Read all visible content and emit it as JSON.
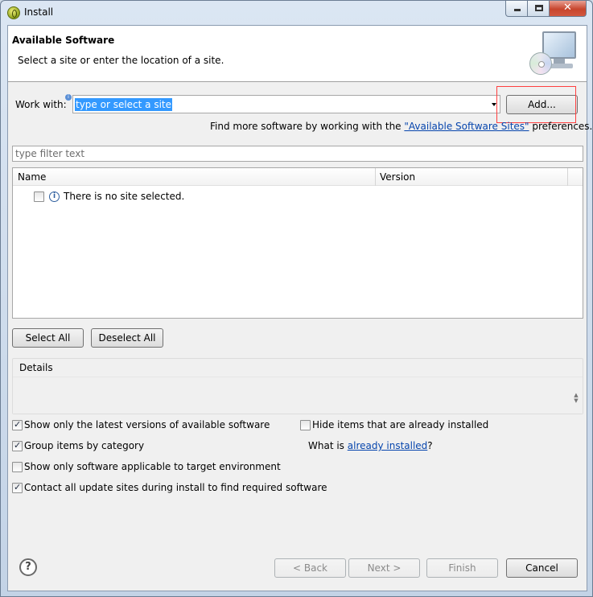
{
  "window": {
    "title": "Install"
  },
  "header": {
    "title": "Available Software",
    "description": "Select a site or enter the location of a site."
  },
  "work_with": {
    "label": "Work with:",
    "value": "type or select a site",
    "add_button": "Add...",
    "hint_prefix": "Find more software by working with the ",
    "hint_link": "\"Available Software Sites\"",
    "hint_suffix": " preferences."
  },
  "filter": {
    "placeholder": "type filter text"
  },
  "table": {
    "columns": [
      "Name",
      "Version"
    ],
    "rows": [
      {
        "text": "There is no site selected.",
        "checked": false
      }
    ]
  },
  "selection": {
    "select_all": "Select All",
    "deselect_all": "Deselect All"
  },
  "details": {
    "title": "Details"
  },
  "options": {
    "latest_versions": {
      "label": "Show only the latest versions of available software",
      "checked": true
    },
    "group_by_category": {
      "label": "Group items by category",
      "checked": true
    },
    "applicable_only": {
      "label": "Show only software applicable to target environment",
      "checked": false
    },
    "contact_sites": {
      "label": "Contact all update sites during install to find required software",
      "checked": true
    },
    "hide_installed": {
      "label": "Hide items that are already installed",
      "checked": false
    },
    "what_is_prefix": "What is ",
    "what_is_link": "already installed",
    "what_is_suffix": "?"
  },
  "footer": {
    "back": "< Back",
    "next": "Next >",
    "finish": "Finish",
    "cancel": "Cancel"
  }
}
